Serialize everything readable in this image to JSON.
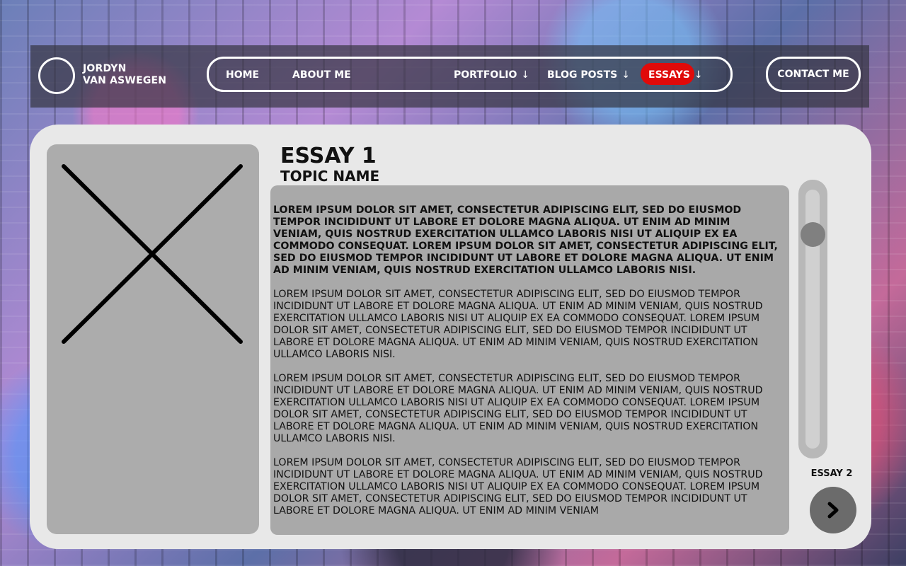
{
  "brand": {
    "name_line1": "JORDYN",
    "name_line2": "VAN ASWEGEN"
  },
  "nav": {
    "items": [
      {
        "label": "HOME",
        "arrow": ""
      },
      {
        "label": "ABOUT ME",
        "arrow": ""
      },
      {
        "label": "PORTFOLIO",
        "arrow": "↓"
      },
      {
        "label": "BLOG POSTS",
        "arrow": "↓"
      },
      {
        "label": "ESSAYS",
        "arrow": "↓",
        "active": true
      }
    ],
    "contact_label": "CONTACT ME",
    "active_color": "#e00a0a"
  },
  "essay": {
    "title": "ESSAY 1",
    "topic": "TOPIC NAME",
    "paragraphs": [
      "LOREM IPSUM DOLOR SIT AMET, CONSECTETUR ADIPISCING ELIT, SED DO EIUSMOD TEMPOR INCIDIDUNT UT LABORE ET DOLORE MAGNA ALIQUA. UT ENIM AD MINIM VENIAM, QUIS NOSTRUD EXERCITATION ULLAMCO LABORIS NISI UT ALIQUIP EX EA COMMODO CONSEQUAT. LOREM IPSUM DOLOR SIT AMET, CONSECTETUR ADIPISCING ELIT, SED DO EIUSMOD TEMPOR INCIDIDUNT UT LABORE ET DOLORE MAGNA ALIQUA. UT ENIM AD MINIM VENIAM, QUIS NOSTRUD EXERCITATION ULLAMCO LABORIS NISI.",
      "LOREM IPSUM DOLOR SIT AMET, CONSECTETUR ADIPISCING ELIT, SED DO EIUSMOD TEMPOR INCIDIDUNT UT LABORE ET DOLORE MAGNA ALIQUA. UT ENIM AD MINIM VENIAM, QUIS NOSTRUD EXERCITATION ULLAMCO LABORIS NISI UT ALIQUIP EX EA COMMODO CONSEQUAT. LOREM IPSUM DOLOR SIT AMET, CONSECTETUR ADIPISCING ELIT, SED DO EIUSMOD TEMPOR INCIDIDUNT UT LABORE ET DOLORE MAGNA ALIQUA. UT ENIM AD MINIM VENIAM, QUIS NOSTRUD EXERCITATION ULLAMCO LABORIS NISI.",
      "LOREM IPSUM DOLOR SIT AMET, CONSECTETUR ADIPISCING ELIT, SED DO EIUSMOD TEMPOR INCIDIDUNT UT LABORE ET DOLORE MAGNA ALIQUA. UT ENIM AD MINIM VENIAM, QUIS NOSTRUD EXERCITATION ULLAMCO LABORIS NISI UT ALIQUIP EX EA COMMODO CONSEQUAT. LOREM IPSUM DOLOR SIT AMET, CONSECTETUR ADIPISCING ELIT, SED DO EIUSMOD TEMPOR INCIDIDUNT UT LABORE ET DOLORE MAGNA ALIQUA. UT ENIM AD MINIM VENIAM, QUIS NOSTRUD EXERCITATION ULLAMCO LABORIS NISI.",
      "LOREM IPSUM DOLOR SIT AMET, CONSECTETUR ADIPISCING ELIT, SED DO EIUSMOD TEMPOR INCIDIDUNT UT LABORE ET DOLORE MAGNA ALIQUA. UT ENIM AD MINIM VENIAM, QUIS NOSTRUD EXERCITATION ULLAMCO LABORIS NISI UT ALIQUIP EX EA COMMODO CONSEQUAT. LOREM IPSUM DOLOR SIT AMET, CONSECTETUR ADIPISCING ELIT, SED DO EIUSMOD TEMPOR INCIDIDUNT UT LABORE ET DOLORE MAGNA ALIQUA. UT ENIM AD MINIM VENIAM"
    ],
    "image_icon": "image-placeholder-x-icon",
    "scroll_position": 0.15
  },
  "next": {
    "label": "ESSAY 2",
    "icon": "chevron-right-icon"
  }
}
